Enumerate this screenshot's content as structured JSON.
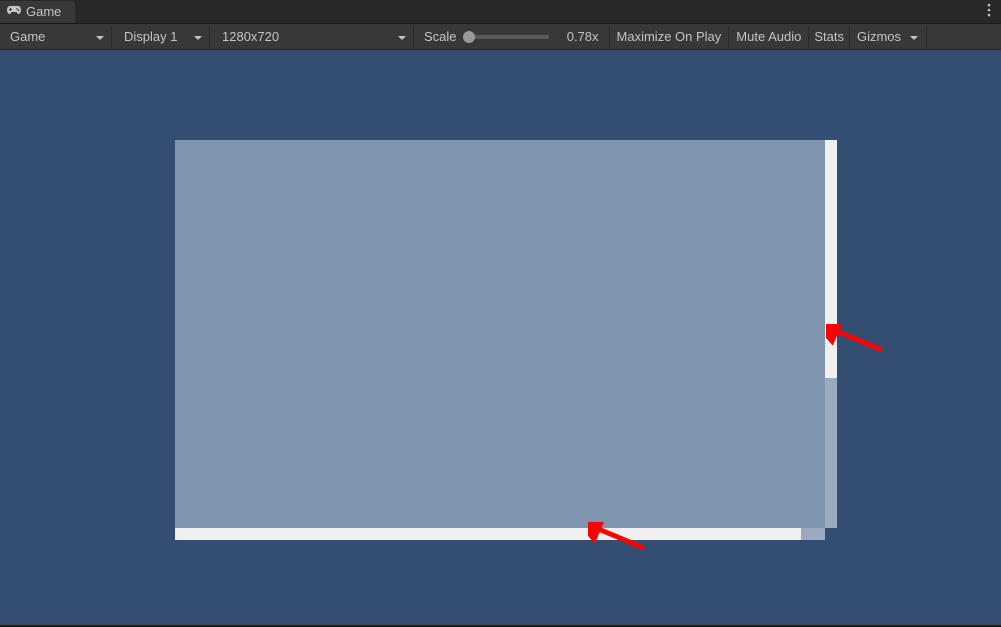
{
  "tab": {
    "label": "Game"
  },
  "toolbar": {
    "view_select": "Game",
    "display_select": "Display 1",
    "resolution_select": "1280x720",
    "scale_label": "Scale",
    "scale_value": "0.78x",
    "maximize_label": "Maximize On Play",
    "mute_label": "Mute Audio",
    "stats_label": "Stats",
    "gizmos_label": "Gizmos"
  },
  "colors": {
    "viewport_bg": "#344e71",
    "panel_bg": "#7e94af",
    "annotation_arrow": "#ff0000"
  }
}
